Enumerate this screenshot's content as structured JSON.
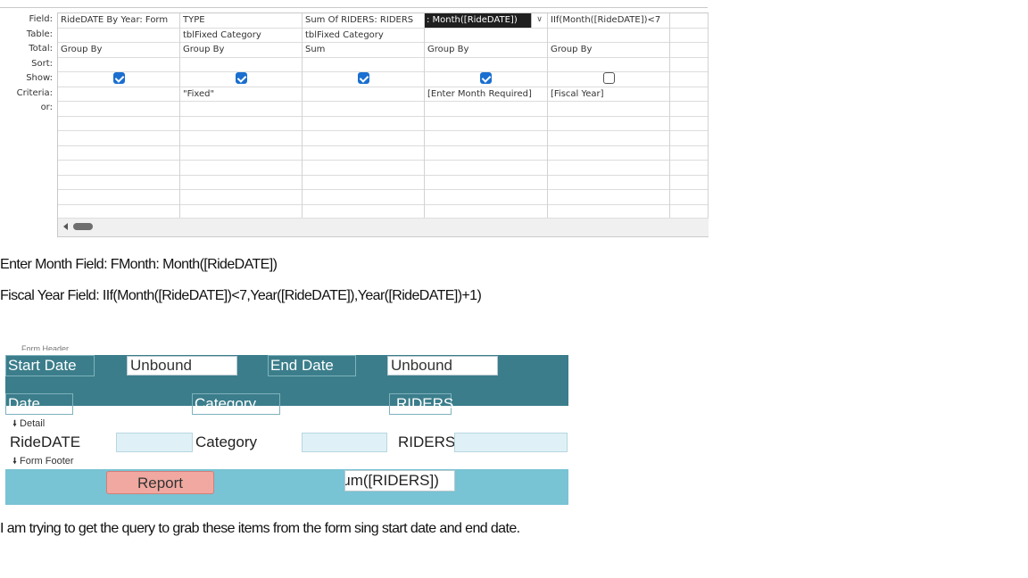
{
  "query_grid": {
    "row_labels": [
      "Field:",
      "Table:",
      "Total:",
      "Sort:",
      "Show:",
      "Criteria:",
      "or:"
    ],
    "columns": [
      {
        "field": "RideDATE By Year: Form",
        "table": "",
        "total": "Group By",
        "sort": "",
        "show": true,
        "criteria": "",
        "selected": false
      },
      {
        "field": "TYPE",
        "table": "tblFixed Category",
        "total": "Group By",
        "sort": "",
        "show": true,
        "criteria": "\"Fixed\"",
        "selected": false
      },
      {
        "field": "Sum Of RIDERS: RIDERS",
        "table": "tblFixed Category",
        "total": "Sum",
        "sort": "",
        "show": true,
        "criteria": "",
        "selected": false
      },
      {
        "field": ": Month([RideDATE])",
        "table": "",
        "total": "Group By",
        "sort": "",
        "show": true,
        "criteria": "[Enter Month Required]",
        "selected": true
      },
      {
        "field": "IIf(Month([RideDATE])<7",
        "table": "",
        "total": "Group By",
        "sort": "",
        "show": false,
        "criteria": "[Fiscal Year]",
        "selected": false
      },
      {
        "field": "",
        "table": "",
        "total": "",
        "sort": "",
        "show": null,
        "criteria": "",
        "selected": false
      }
    ]
  },
  "notes": {
    "enter_month": "Enter Month Field:   FMonth: Month([RideDATE])",
    "fiscal_year": "Fiscal Year Field:  IIf(Month([RideDATE])<7,Year([RideDATE]),Year([RideDATE])+1)",
    "question": "I am trying to get the query to grab these items from the form sing start date and end date."
  },
  "form": {
    "header_section_label": "Form Header",
    "start_date_label": "Start Date",
    "start_date_value": "Unbound",
    "end_date_label": "End Date",
    "end_date_value": "Unbound",
    "col_date": "Date",
    "col_category": "Category",
    "col_riders": "RIDERS",
    "detail_section_label": "Detail",
    "detail_ridedate": "RideDATE",
    "detail_category": "Category",
    "detail_riders": "RIDERS",
    "footer_section_label": "Form Footer",
    "report_button": "Report",
    "sum_expression": "=Sum([RIDERS])"
  },
  "colors": {
    "header_band": "#3b7d8b",
    "footer_band": "#78c3d4",
    "report_button": "#f0a8a0",
    "checkbox_on": "#1a6fd0"
  }
}
